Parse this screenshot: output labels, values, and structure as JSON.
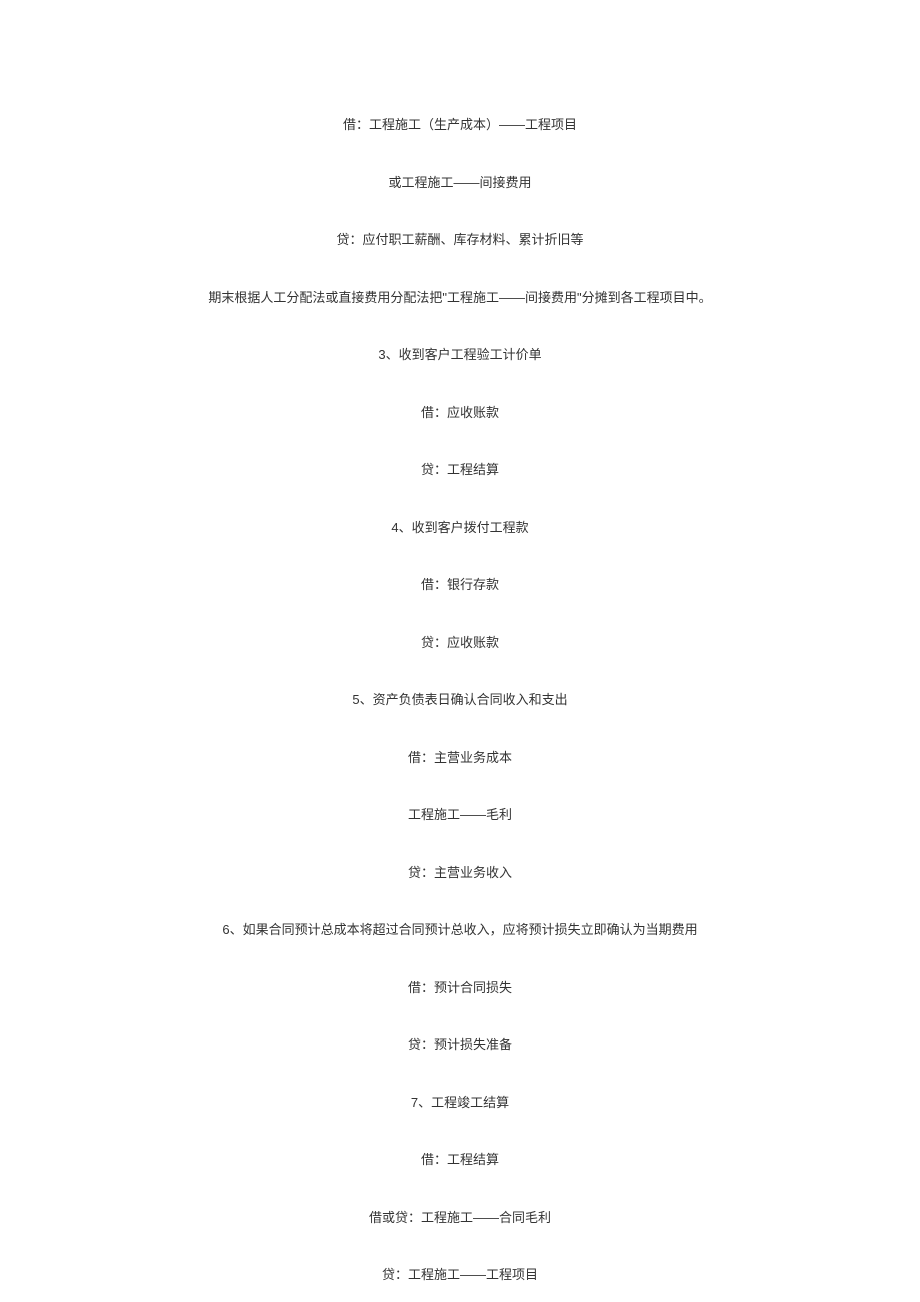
{
  "lines": [
    "借：工程施工（生产成本）——工程项目",
    "或工程施工——间接费用",
    "贷：应付职工薪酬、库存材料、累计折旧等",
    "期末根据人工分配法或直接费用分配法把\"工程施工——间接费用\"分摊到各工程项目中。",
    "3、收到客户工程验工计价单",
    "借：应收账款",
    "贷：工程结算",
    "4、收到客户拨付工程款",
    "借：银行存款",
    "贷：应收账款",
    "5、资产负债表日确认合同收入和支出",
    "借：主营业务成本",
    "工程施工——毛利",
    "贷：主营业务收入",
    "6、如果合同预计总成本将超过合同预计总收入，应将预计损失立即确认为当期费用",
    "借：预计合同损失",
    "贷：预计损失准备",
    "7、工程竣工结算",
    "借：工程结算",
    "借或贷：工程施工——合同毛利",
    "贷：工程施工——工程项目"
  ]
}
